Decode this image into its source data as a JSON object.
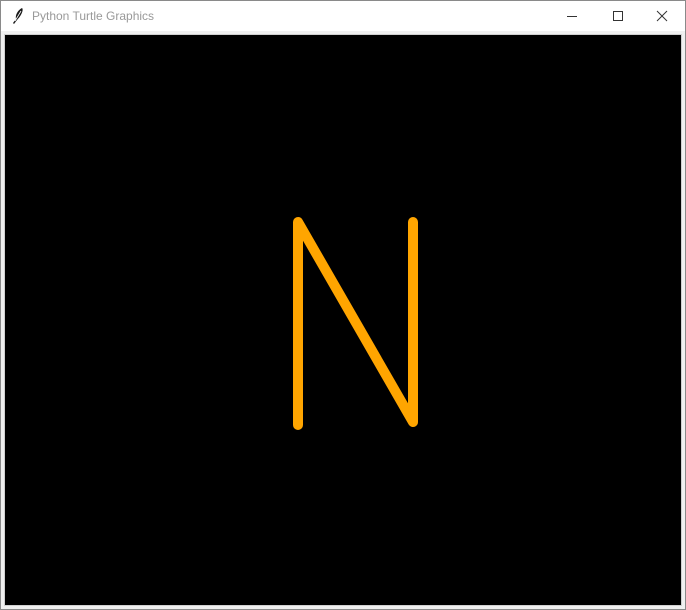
{
  "window": {
    "title": "Python Turtle Graphics",
    "controls": {
      "minimize_icon": "minimize-icon",
      "maximize_icon": "maximize-icon",
      "close_icon": "close-icon"
    }
  },
  "canvas": {
    "background_color": "#000000",
    "pen_color": "#ffa500",
    "drawing": "N"
  }
}
